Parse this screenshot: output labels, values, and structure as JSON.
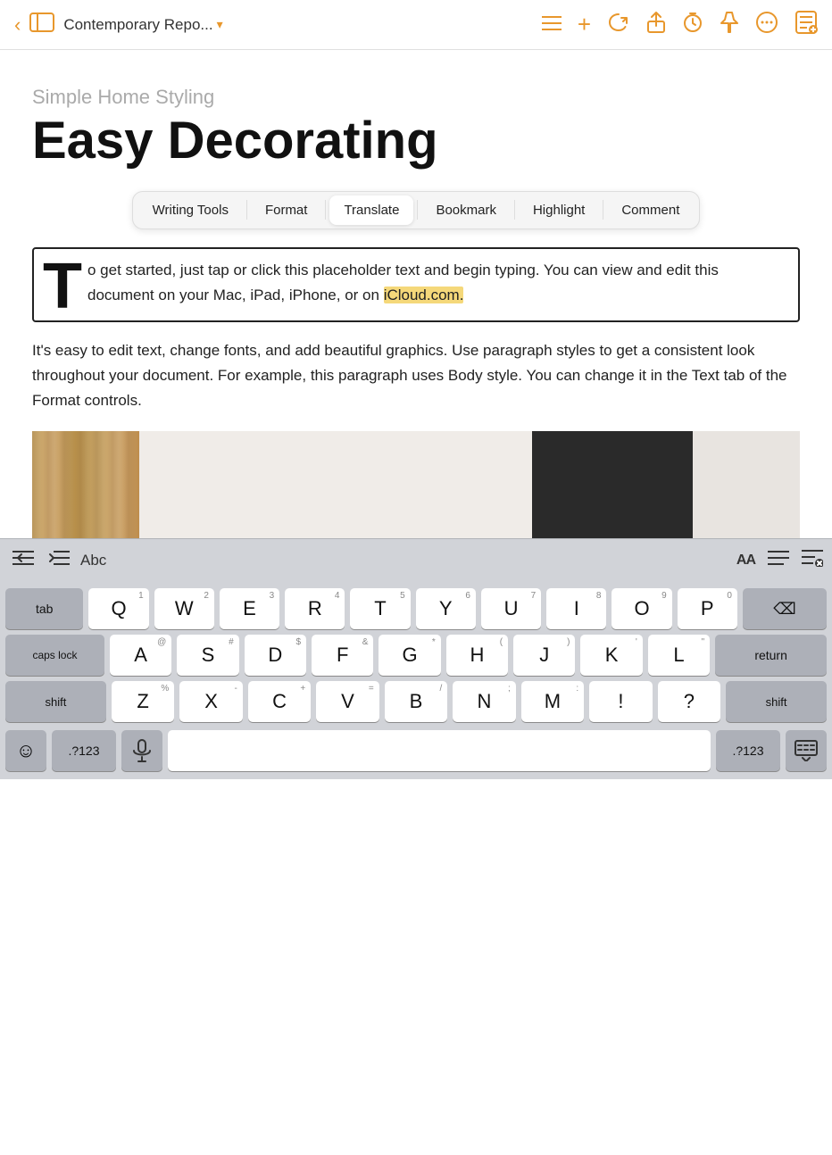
{
  "toolbar": {
    "back_icon": "‹",
    "sidebar_icon": "⊞",
    "title": "Contemporary Repo...",
    "chevron": "⌄",
    "list_icon": "≡",
    "add_icon": "+",
    "lasso_icon": "✦",
    "share_icon": "⬆",
    "timer_icon": "◷",
    "pin_icon": "✎",
    "more_icon": "•••",
    "note_icon": "🗒"
  },
  "document": {
    "subtitle": "Simple Home Styling",
    "title": "Easy Decorating",
    "context_menu": [
      {
        "id": "writing-tools",
        "label": "Writing Tools",
        "active": false
      },
      {
        "id": "format",
        "label": "Format",
        "active": false
      },
      {
        "id": "translate",
        "label": "Translate",
        "active": true
      },
      {
        "id": "bookmark",
        "label": "Bookmark",
        "active": false
      },
      {
        "id": "highlight",
        "label": "Highlight",
        "active": false
      },
      {
        "id": "comment",
        "label": "Comment",
        "active": false
      }
    ],
    "dropcap_letter": "T",
    "dropcap_text": "o get started, just tap or click this placeholder text and begin typing. You can view and edit this document on your Mac, iPad, iPhone, or on iCloud.com.",
    "body_text": "It's easy to edit text, change fonts, and add beautiful graphics. Use paragraph styles to get a consistent look throughout your document. For example, this paragraph uses Body style. You can change it in the Text tab of the Format controls."
  },
  "keyboard_toolbar": {
    "decrease_indent": "⇤",
    "increase_indent": "⇥",
    "abc": "Abc",
    "text_size": "AA",
    "align_icon": "≡",
    "text_format_icon": "≡̲"
  },
  "keyboard": {
    "row1": [
      {
        "char": "Q",
        "num": "1"
      },
      {
        "char": "W",
        "num": "2"
      },
      {
        "char": "E",
        "num": "3"
      },
      {
        "char": "R",
        "num": "4"
      },
      {
        "char": "T",
        "num": "5"
      },
      {
        "char": "Y",
        "num": "6"
      },
      {
        "char": "U",
        "num": "7"
      },
      {
        "char": "I",
        "num": "8"
      },
      {
        "char": "O",
        "num": "9"
      },
      {
        "char": "P",
        "num": "0"
      }
    ],
    "row2": [
      {
        "char": "A",
        "sym": "@"
      },
      {
        "char": "S",
        "sym": "#"
      },
      {
        "char": "D",
        "sym": "$"
      },
      {
        "char": "F",
        "sym": "&"
      },
      {
        "char": "G",
        "sym": "*"
      },
      {
        "char": "H",
        "sym": "("
      },
      {
        "char": "J",
        "sym": ")"
      },
      {
        "char": "K",
        "sym": "'"
      },
      {
        "char": "L",
        "sym": "\""
      }
    ],
    "row3": [
      {
        "char": "Z",
        "sym": "%"
      },
      {
        "char": "X",
        "sym": "-"
      },
      {
        "char": "C",
        "sym": "+"
      },
      {
        "char": "V",
        "sym": "="
      },
      {
        "char": "B",
        "sym": "/"
      },
      {
        "char": "N",
        "sym": ";"
      },
      {
        "char": "M",
        "sym": ":"
      }
    ],
    "special": {
      "tab": "tab",
      "delete": "⌫",
      "caps_lock": "caps lock",
      "return": "return",
      "shift": "shift",
      "num_toggle": ".?123",
      "space": "",
      "hide_kb": "⌨",
      "emoji": "☺",
      "dictate": "🎙",
      "exclaim": "!",
      "question": "?",
      "comma": ",",
      "period": "."
    }
  }
}
